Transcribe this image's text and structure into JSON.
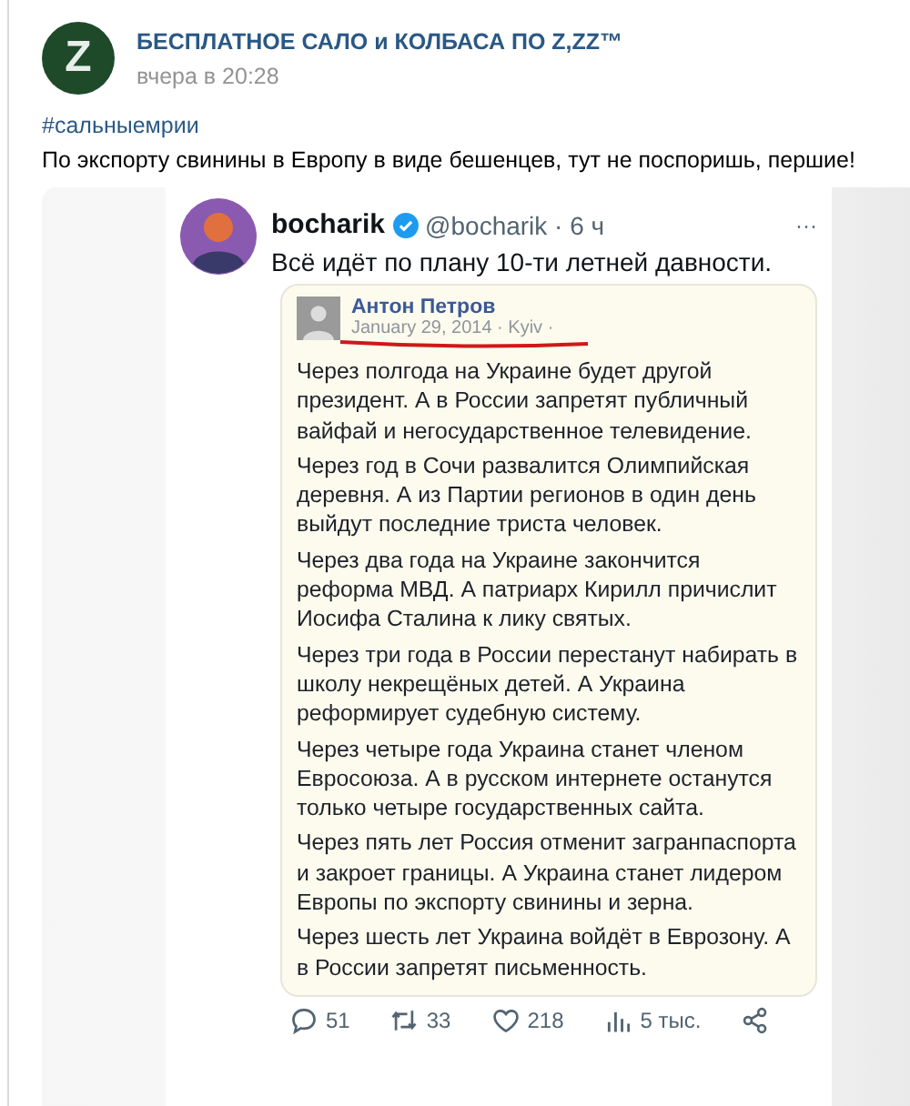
{
  "post": {
    "logo_letter": "Z",
    "author": "БЕСПЛАТНОЕ САЛО и КОЛБАСА ПО Z,ZZ™",
    "time": "вчера в 20:28",
    "hashtag": "#сальныемрии",
    "text": "По экспорту свинины в Европу в виде бешенцев, тут не поспоришь, першие!"
  },
  "tweet": {
    "name": "bocharik",
    "verified": true,
    "handle": "@bocharik · 6 ч",
    "menu": "···",
    "text": "Всё идёт по плану 10-ти летней давности.",
    "quoted": {
      "author": "Антон Петров",
      "date": "January 29, 2014 · Kyiv ·",
      "paragraphs": [
        "Через полгода на Украине будет другой президент. А в России запретят публичный вайфай и негосударственное телевидение.",
        "Через год в Сочи развалится Олимпийская деревня. А из Партии регионов в один день выйдут последние триста человек.",
        "Через два года на Украине закончится реформа МВД. А патриарх Кирилл причислит Иосифа Сталина к лику святых.",
        "Через три года в России перестанут набирать в школу некрещёных детей. А Украина реформирует судебную систему.",
        "Через четыре года Украина станет членом Евросоюза. А в русском интернете останутся только четыре государственных сайта.",
        "Через пять лет Россия отменит загранпаспорта и закроет границы. А Украина станет лидером Европы по экспорту свинины и зерна.",
        "Через шесть лет Украина войдёт в Еврозону. А в России запретят письменность."
      ]
    },
    "stats": [
      {
        "kind": "reply",
        "count": "51"
      },
      {
        "kind": "retweet",
        "count": "33"
      },
      {
        "kind": "like",
        "count": "218"
      },
      {
        "kind": "views",
        "count": "5 тыс."
      },
      {
        "kind": "share"
      }
    ]
  }
}
